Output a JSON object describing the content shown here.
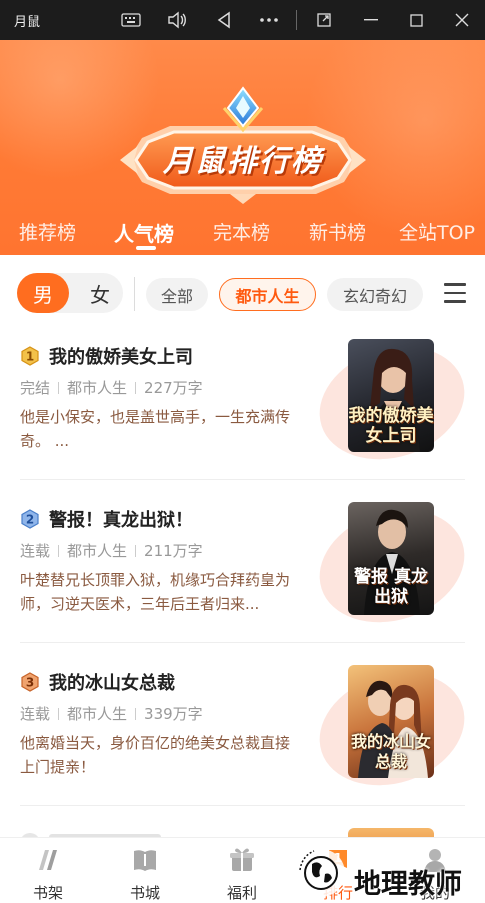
{
  "window": {
    "title": "月鼠",
    "buttons": [
      "keyboard-icon",
      "volume-icon",
      "back-icon",
      "more-icon",
      "popout-icon",
      "minimize-icon",
      "maximize-icon",
      "close-icon"
    ]
  },
  "header": {
    "banner_title": "月鼠排行榜",
    "tabs": [
      {
        "label": "推荐榜",
        "active": false
      },
      {
        "label": "人气榜",
        "active": true
      },
      {
        "label": "完本榜",
        "active": false
      },
      {
        "label": "新书榜",
        "active": false
      },
      {
        "label": "全站TOP",
        "active": false
      }
    ]
  },
  "filters": {
    "gender": {
      "male": "男",
      "female": "女",
      "selected": "男"
    },
    "categories": [
      {
        "label": "全部",
        "active": false
      },
      {
        "label": "都市人生",
        "active": true
      },
      {
        "label": "玄幻奇幻",
        "active": false
      }
    ]
  },
  "books": [
    {
      "rank": "1",
      "title": "我的傲娇美女上司",
      "status": "完结",
      "category": "都市人生",
      "words": "227万字",
      "description": "他是小保安，也是盖世高手，一生充满传奇。 ...",
      "cover_text": "我的傲娇美女上司"
    },
    {
      "rank": "2",
      "title": "警报！真龙出狱！",
      "status": "连载",
      "category": "都市人生",
      "words": "211万字",
      "description": "叶楚替兄长顶罪入狱，机缘巧合拜药皇为师，习逆天医术，三年后王者归来...",
      "cover_text": "警报 真龙出狱"
    },
    {
      "rank": "3",
      "title": "我的冰山女总裁",
      "status": "连载",
      "category": "都市人生",
      "words": "339万字",
      "description": "他离婚当天，身价百亿的绝美女总裁直接上门提亲！",
      "cover_text": "我的冰山女总裁"
    }
  ],
  "bottom_nav": [
    {
      "label": "书架",
      "icon": "bookshelf-icon",
      "active": false
    },
    {
      "label": "书城",
      "icon": "book-store-icon",
      "active": false
    },
    {
      "label": "福利",
      "icon": "gift-icon",
      "active": false
    },
    {
      "label": "排行",
      "icon": "rank-icon",
      "active": true
    },
    {
      "label": "我的",
      "icon": "profile-icon",
      "active": false
    }
  ],
  "watermark": {
    "text": "地理教师"
  },
  "colors": {
    "accent": "#ff6d1f",
    "header": "#ff7a35",
    "rank1": "#e8a21c",
    "rank2": "#5b8fd6",
    "rank3": "#d9783a"
  }
}
